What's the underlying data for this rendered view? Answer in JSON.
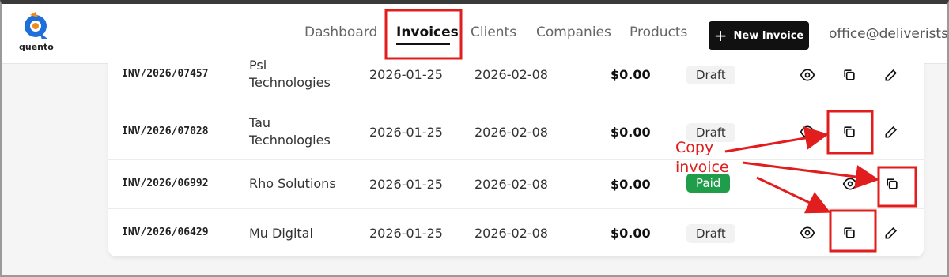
{
  "app": {
    "logo_text": "quento"
  },
  "nav": {
    "items": [
      {
        "label": "Dashboard"
      },
      {
        "label": "Invoices"
      },
      {
        "label": "Clients"
      },
      {
        "label": "Companies"
      },
      {
        "label": "Products"
      }
    ],
    "active": "Invoices",
    "new_invoice_label": "New Invoice",
    "user_email": "office@deliverists."
  },
  "invoices": [
    {
      "number": "INV/2026/07457",
      "client_line1": "Psi",
      "client_line2": "Technologies",
      "issued": "2026-01-25",
      "due": "2026-02-08",
      "amount": "$0.00",
      "status": "Draft"
    },
    {
      "number": "INV/2026/07028",
      "client_line1": "Tau",
      "client_line2": "Technologies",
      "issued": "2026-01-25",
      "due": "2026-02-08",
      "amount": "$0.00",
      "status": "Draft"
    },
    {
      "number": "INV/2026/06992",
      "client_line1": "Rho Solutions",
      "client_line2": "",
      "issued": "2026-01-25",
      "due": "2026-02-08",
      "amount": "$0.00",
      "status": "Paid"
    },
    {
      "number": "INV/2026/06429",
      "client_line1": "Mu Digital",
      "client_line2": "",
      "issued": "2026-01-25",
      "due": "2026-02-08",
      "amount": "$0.00",
      "status": "Draft"
    }
  ],
  "annotation": {
    "line1": "Copy",
    "line2": "invoice",
    "color": "#e11d1d"
  },
  "colors": {
    "paid": "#1f9d4a",
    "draft_bg": "#f2f2f2",
    "primary_button": "#111111"
  }
}
